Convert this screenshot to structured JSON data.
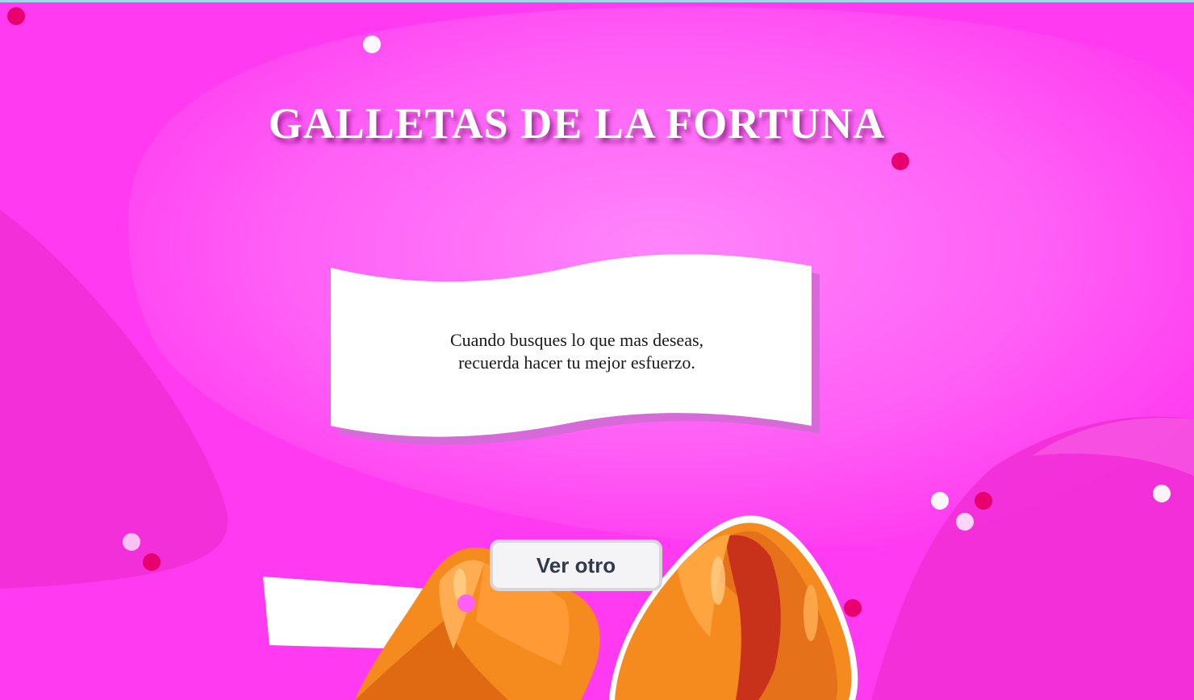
{
  "title": "GALLETAS DE LA FORTUNA",
  "fortune": {
    "line1": "Cuando busques lo que mas deseas,",
    "line2": "recuerda hacer tu mejor esfuerzo."
  },
  "button": {
    "label": "Ver otro"
  },
  "colors": {
    "background": "#ff3af0",
    "highlight": "#ff80fb",
    "dot_dark": "#e8006e",
    "dot_light": "#ffffff",
    "cookie": "#f58a1f",
    "paper": "#ffffff",
    "paper_shadow": "#d56ad8"
  }
}
